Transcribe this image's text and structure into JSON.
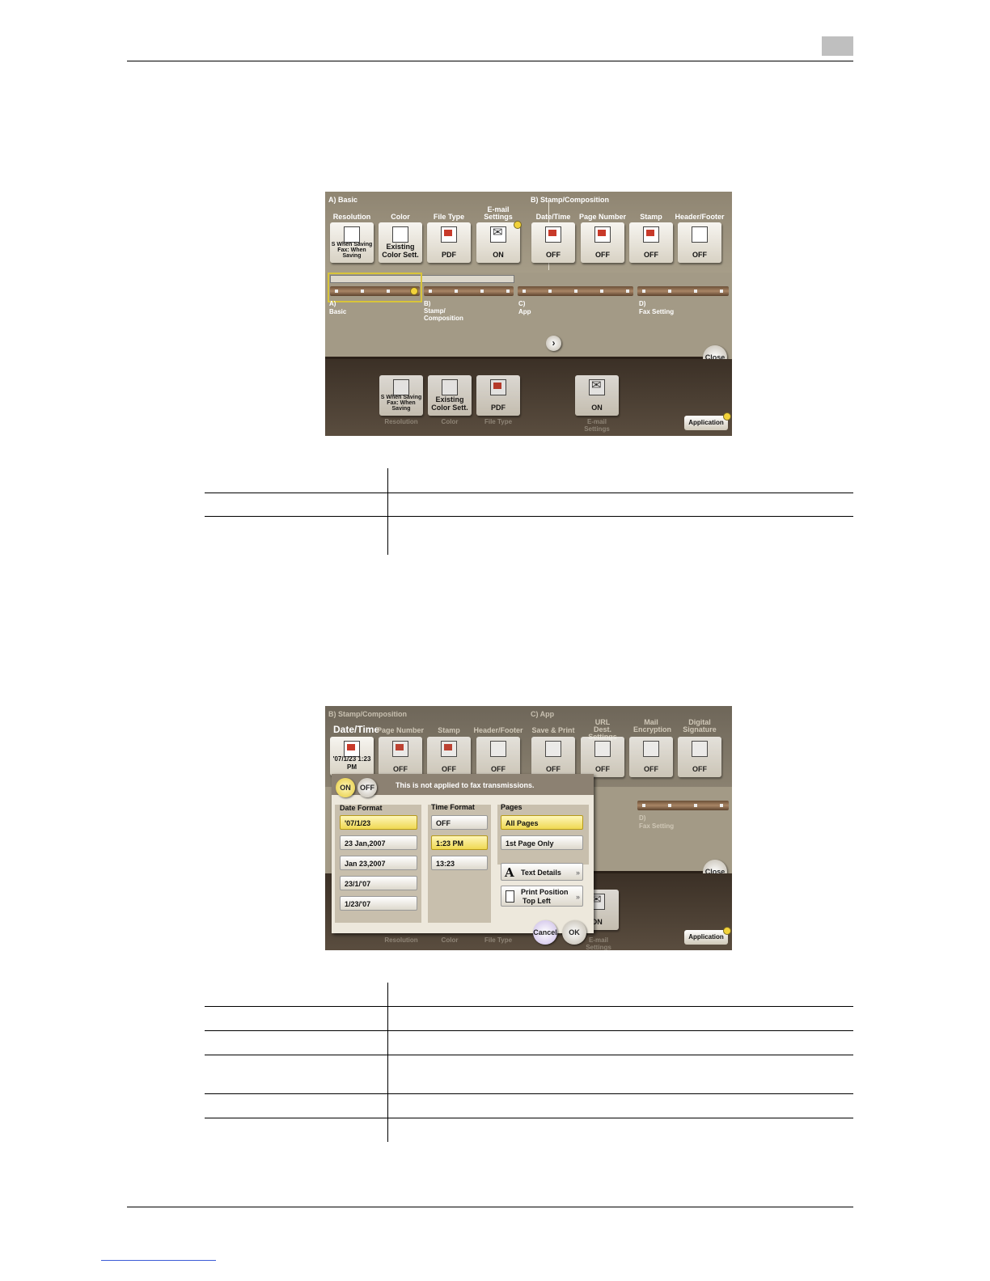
{
  "screen1": {
    "sections": {
      "basic": "A)   Basic",
      "stamp": "B)   Stamp/Composition"
    },
    "items": [
      {
        "label": "Resolution",
        "value": "S When Saving Fax: When Saving"
      },
      {
        "label": "Color",
        "value": "Existing Color Sett."
      },
      {
        "label": "File Type",
        "value": "PDF"
      },
      {
        "label": "E-mail Settings",
        "value": "ON"
      },
      {
        "label": "Date/Time",
        "value": "OFF"
      },
      {
        "label": "Page Number",
        "value": "OFF"
      },
      {
        "label": "Stamp",
        "value": "OFF"
      },
      {
        "label": "Header/Footer",
        "value": "OFF"
      }
    ],
    "nav": [
      {
        "letter": "A)",
        "name": "Basic"
      },
      {
        "letter": "B)",
        "name": "Stamp/ Composition"
      },
      {
        "letter": "C)",
        "name": "App"
      },
      {
        "letter": "D)",
        "name": "Fax Setting"
      }
    ],
    "close": "Close",
    "application": "Application",
    "bottom_items": [
      {
        "label": "Resolution",
        "value": "S When Saving Fax: When Saving"
      },
      {
        "label": "Color",
        "value": "Existing Color Sett."
      },
      {
        "label": "File Type",
        "value": "PDF"
      },
      {
        "label": "E-mail Settings",
        "value": "ON"
      }
    ]
  },
  "screen2": {
    "sections": {
      "stamp": "B)   Stamp/Composition",
      "app": "C)   App"
    },
    "title": "Date/Time",
    "items": [
      {
        "label": "",
        "value": "'07/1/23 1:23 PM"
      },
      {
        "label": "Page Number",
        "value": "OFF"
      },
      {
        "label": "Stamp",
        "value": "OFF"
      },
      {
        "label": "Header/Footer",
        "value": "OFF"
      },
      {
        "label": "Save & Print",
        "value": "OFF"
      },
      {
        "label": "URL Dest. Settings",
        "value": "OFF"
      },
      {
        "label": "Mail Encryption",
        "value": "OFF"
      },
      {
        "label": "Digital Signature",
        "value": "OFF"
      }
    ],
    "on": "ON",
    "off": "OFF",
    "notice": "This is not applied to fax transmissions.",
    "date_format": {
      "label": "Date Format",
      "options": [
        "'07/1/23",
        "23 Jan,2007",
        "Jan 23,2007",
        "23/1/'07",
        "1/23/'07"
      ]
    },
    "time_format": {
      "label": "Time Format",
      "options": [
        "OFF",
        "1:23 PM",
        "13:23"
      ]
    },
    "pages": {
      "label": "Pages",
      "options": [
        "All Pages",
        "1st Page Only"
      ]
    },
    "text_details": "Text Details",
    "print_position": "Print Position",
    "print_position_value": "Top Left",
    "cancel": "Cancel",
    "ok": "OK",
    "fax_letter": "D)",
    "fax_name": "Fax Setting",
    "close": "Close",
    "application": "Application",
    "email_value": "ON",
    "email_label": "E-mail Settings",
    "bottom_labels": [
      "Resolution",
      "Color",
      "File Type"
    ]
  }
}
